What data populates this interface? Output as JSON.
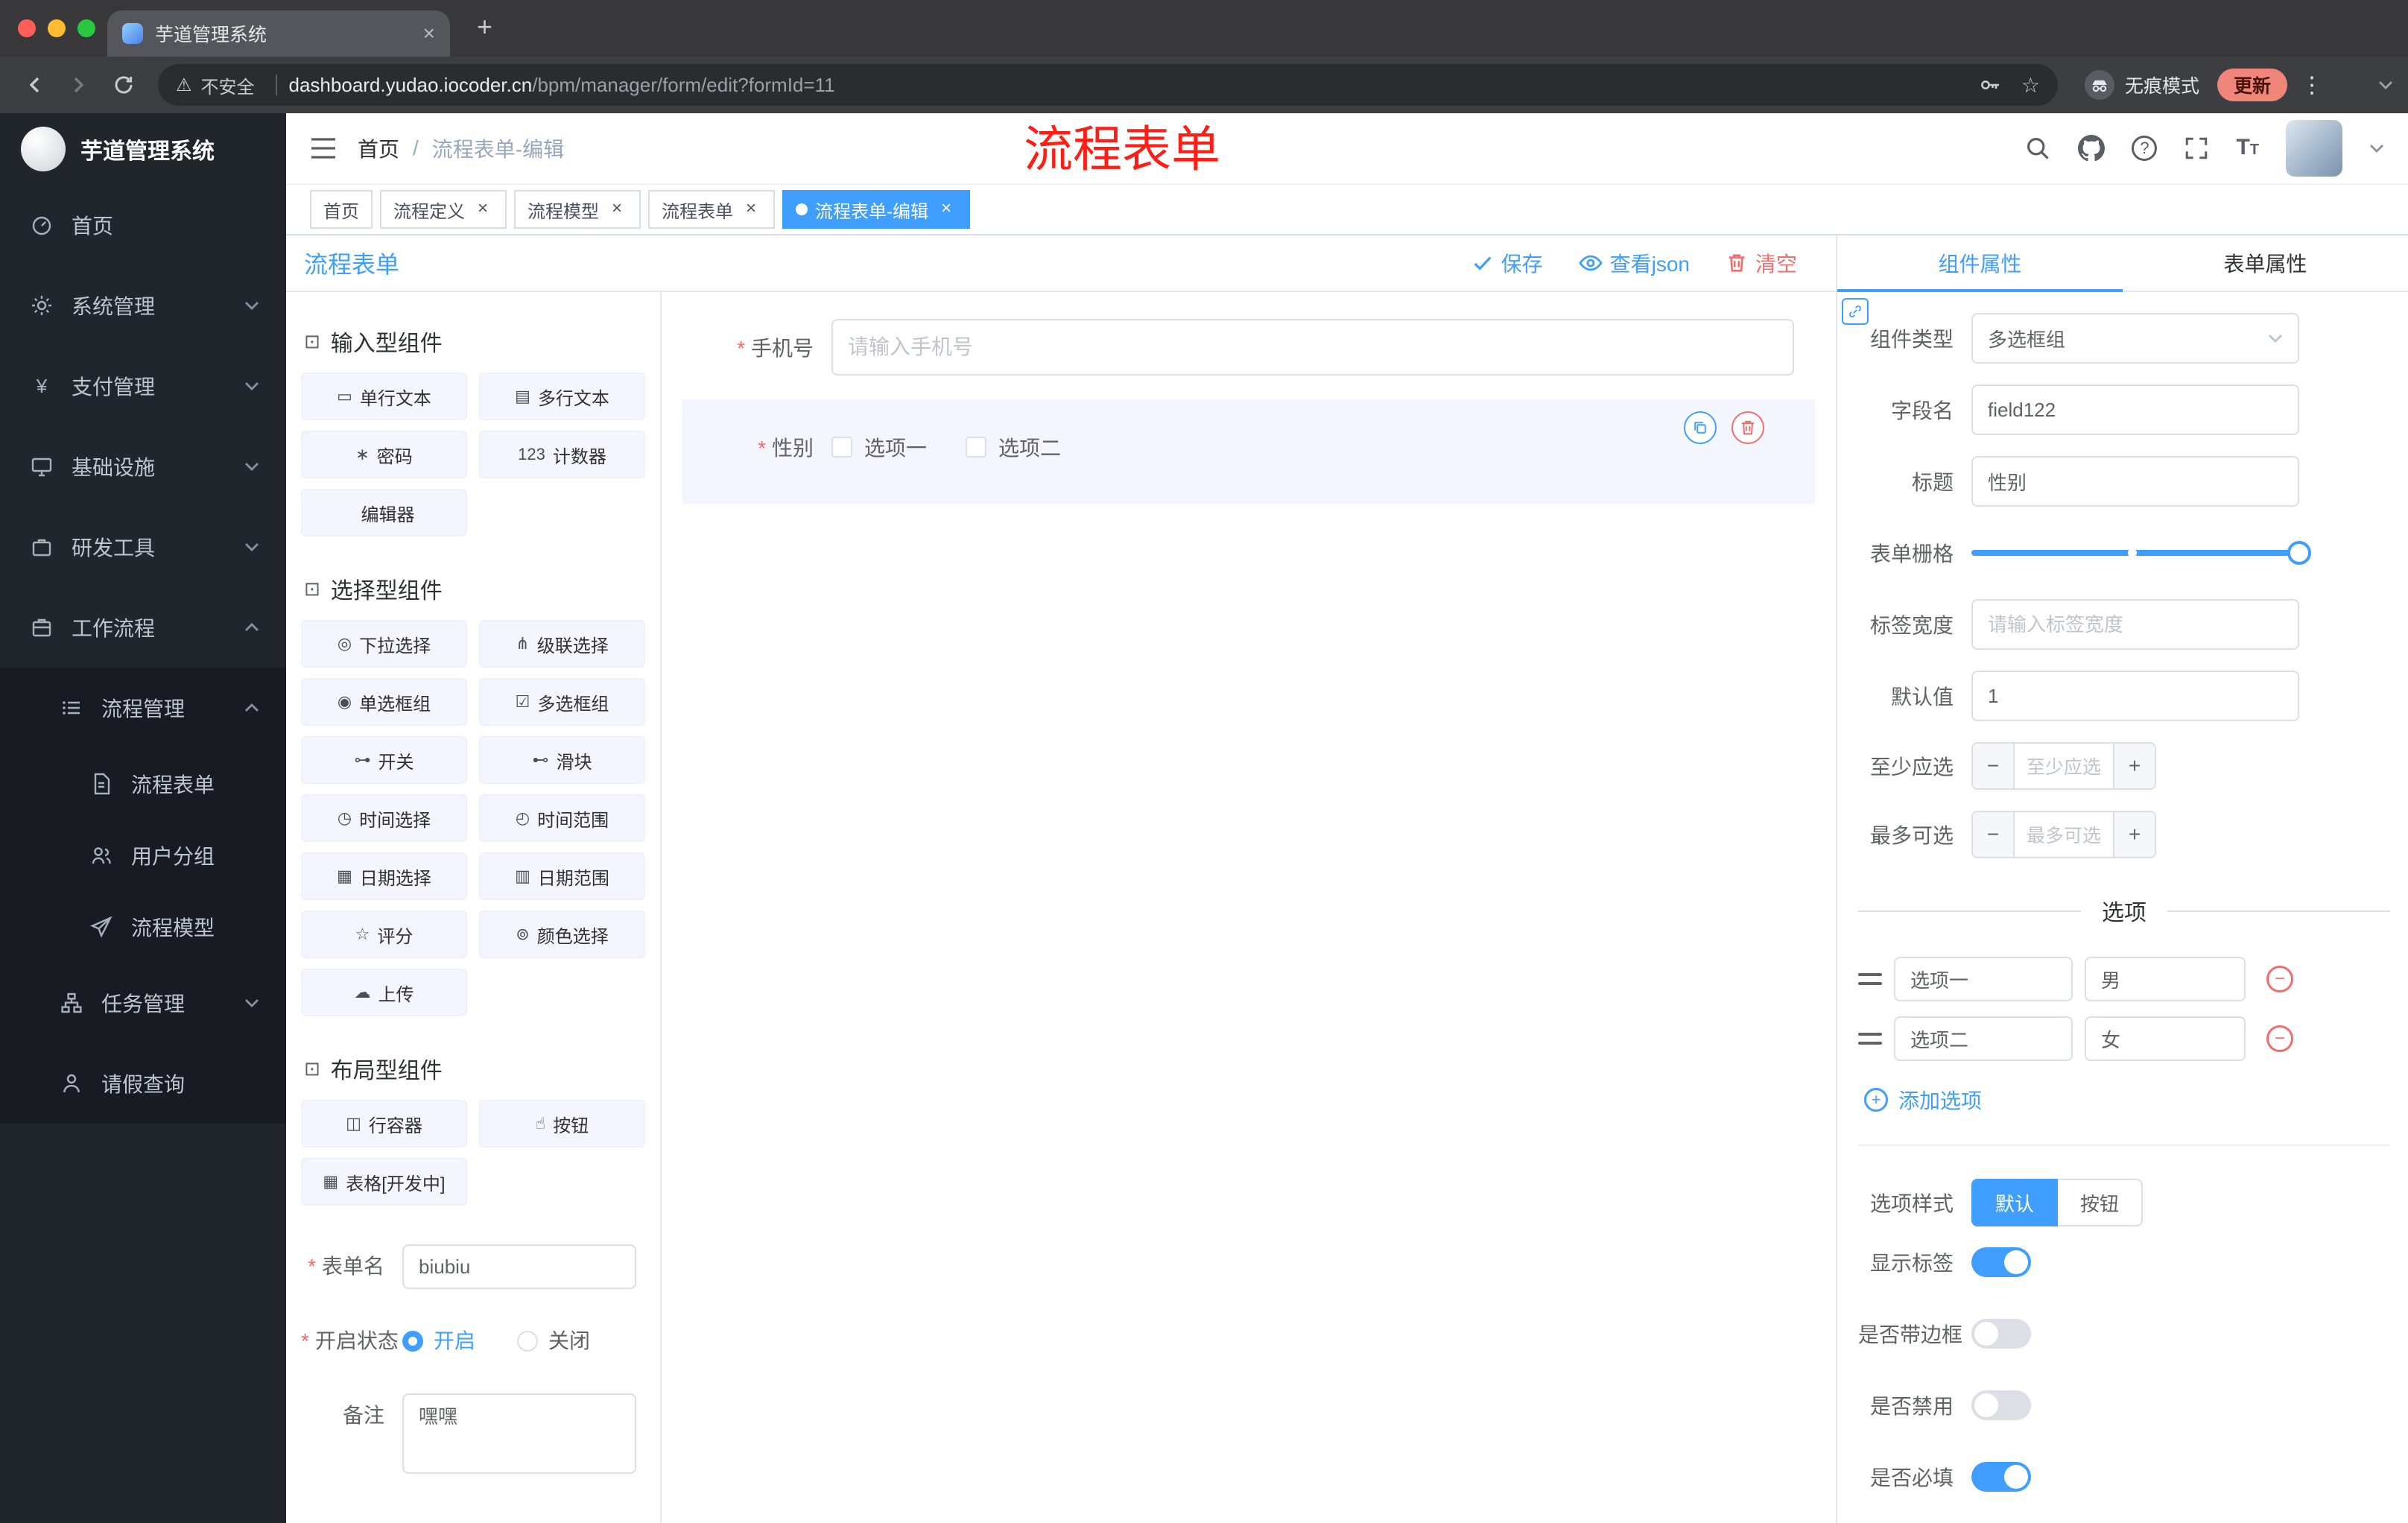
{
  "colors": {
    "accent": "#409eff",
    "danger": "#f56c6c",
    "tag_active": "#409eff",
    "update_chip": "#f08679"
  },
  "icons": {
    "tab_close": "×",
    "new_tab": "+",
    "warning": "⚠",
    "bookmark_star": "☆",
    "kebab_menu": "⋮",
    "minus": "−",
    "plus": "+"
  },
  "browser": {
    "tab_title": "芋道管理系统",
    "security_label": "不安全",
    "url_domain": "dashboard.yudao.iocoder.cn",
    "url_path": "/bpm/manager/form/edit?formId=11",
    "incognito_label": "无痕模式",
    "update_label": "更新"
  },
  "sidebar": {
    "logo_title": "芋道管理系统",
    "menu": {
      "home": "首页",
      "system": "系统管理",
      "payment": "支付管理",
      "infra": "基础设施",
      "devtools": "研发工具",
      "workflow": "工作流程",
      "process_mgmt": "流程管理",
      "process_form": "流程表单",
      "user_group": "用户分组",
      "process_model": "流程模型",
      "task_mgmt": "任务管理",
      "leave_query": "请假查询"
    }
  },
  "header": {
    "breadcrumb_home": "首页",
    "breadcrumb_sep": "/",
    "breadcrumb_current": "流程表单-编辑",
    "annotation": "流程表单"
  },
  "tags": [
    {
      "label": "首页",
      "closable": false,
      "active": false
    },
    {
      "label": "流程定义",
      "closable": true,
      "active": false
    },
    {
      "label": "流程模型",
      "closable": true,
      "active": false
    },
    {
      "label": "流程表单",
      "closable": true,
      "active": false
    },
    {
      "label": "流程表单-编辑",
      "closable": true,
      "active": true
    }
  ],
  "designer": {
    "title": "流程表单",
    "save_label": "保存",
    "view_json_label": "查看json",
    "clear_label": "清空",
    "group_input": {
      "title": "输入型组件",
      "items": [
        {
          "icon": "▭",
          "label": "单行文本"
        },
        {
          "icon": "▤",
          "label": "多行文本"
        },
        {
          "icon": "∗",
          "label": "密码"
        },
        {
          "icon": "123",
          "label": "计数器"
        },
        {
          "icon": "",
          "label": "编辑器"
        }
      ]
    },
    "group_select": {
      "title": "选择型组件",
      "items": [
        {
          "icon": "◎",
          "label": "下拉选择"
        },
        {
          "icon": "⋔",
          "label": "级联选择"
        },
        {
          "icon": "◉",
          "label": "单选框组"
        },
        {
          "icon": "☑",
          "label": "多选框组"
        },
        {
          "icon": "⊶",
          "label": "开关"
        },
        {
          "icon": "⊷",
          "label": "滑块"
        },
        {
          "icon": "◷",
          "label": "时间选择"
        },
        {
          "icon": "◴",
          "label": "时间范围"
        },
        {
          "icon": "▦",
          "label": "日期选择"
        },
        {
          "icon": "▥",
          "label": "日期范围"
        },
        {
          "icon": "☆",
          "label": "评分"
        },
        {
          "icon": "⊚",
          "label": "颜色选择"
        },
        {
          "icon": "☁",
          "label": "上传"
        }
      ]
    },
    "group_layout": {
      "title": "布局型组件",
      "items": [
        {
          "icon": "◫",
          "label": "行容器"
        },
        {
          "icon": "☝",
          "label": "按钮"
        },
        {
          "icon": "▦",
          "label": "表格[开发中]"
        }
      ]
    },
    "meta": {
      "form_name_label": "表单名",
      "form_name_value": "biubiu",
      "status_label": "开启状态",
      "status_on": "开启",
      "status_off": "关闭",
      "remark_label": "备注",
      "remark_value": "嘿嘿"
    },
    "canvas": {
      "phone_label": "手机号",
      "phone_placeholder": "请输入手机号",
      "gender_label": "性别",
      "gender_options": [
        "选项一",
        "选项二"
      ]
    }
  },
  "props": {
    "tab_component": "组件属性",
    "tab_form": "表单属性",
    "type_label": "组件类型",
    "type_value": "多选框组",
    "field_label": "字段名",
    "field_value": "field122",
    "title_label": "标题",
    "title_value": "性别",
    "grid_label": "表单栅格",
    "width_label": "标签宽度",
    "width_placeholder": "请输入标签宽度",
    "default_label": "默认值",
    "default_value": "1",
    "min_label": "至少应选",
    "min_placeholder": "至少应选",
    "max_label": "最多可选",
    "max_placeholder": "最多可选",
    "options_divider": "选项",
    "option_rows": [
      {
        "name": "选项一",
        "value": "男"
      },
      {
        "name": "选项二",
        "value": "女"
      }
    ],
    "add_option": "添加选项",
    "style_label": "选项样式",
    "style_default": "默认",
    "style_button": "按钮",
    "switches": [
      {
        "label": "显示标签",
        "on": true
      },
      {
        "label": "是否带边框",
        "on": false
      },
      {
        "label": "是否禁用",
        "on": false
      },
      {
        "label": "是否必填",
        "on": true
      }
    ]
  }
}
